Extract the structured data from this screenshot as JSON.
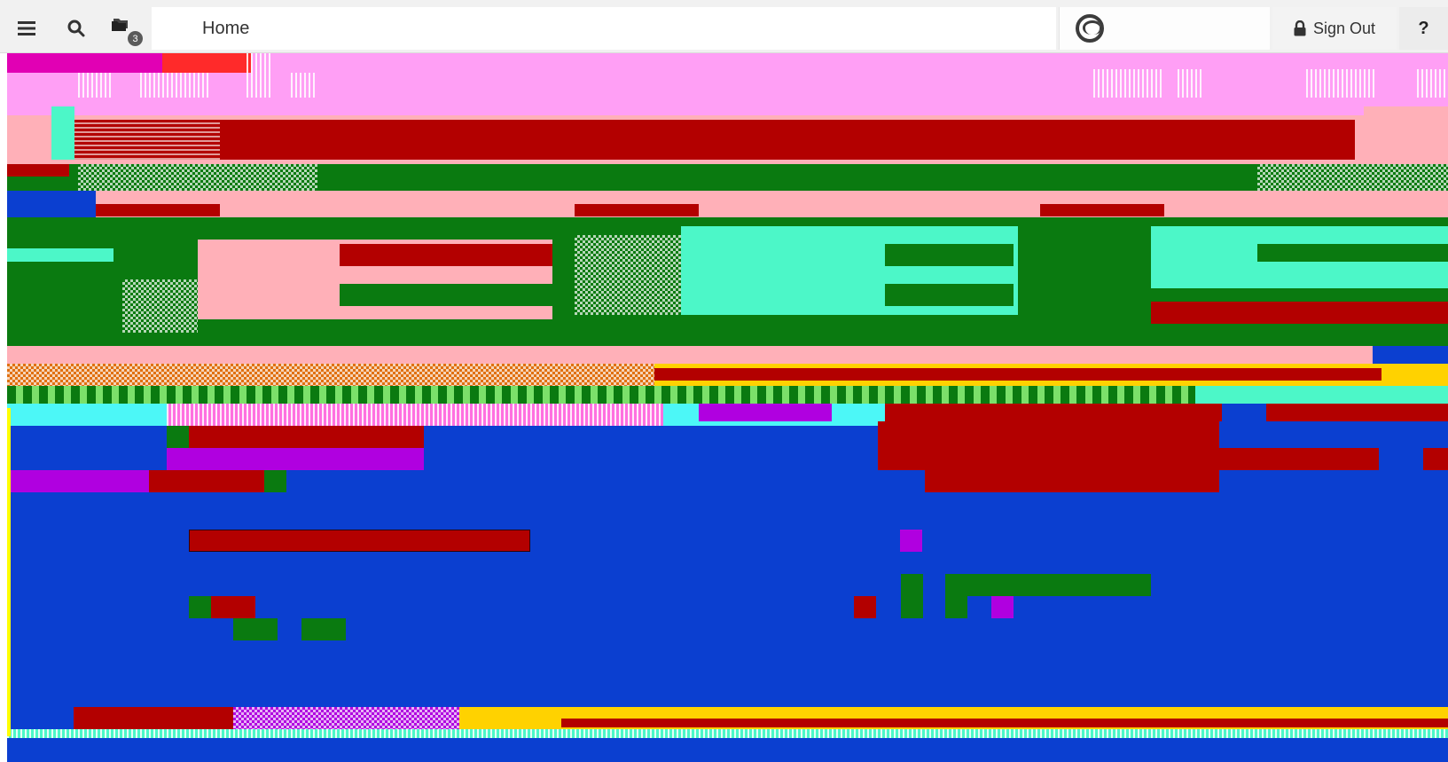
{
  "toolbar": {
    "tasks_badge_count": "3",
    "home_tab_label": "Home",
    "sign_out_label": "Sign Out",
    "help_label": "?"
  },
  "icons": {
    "menu": "hamburger-menu-icon",
    "search": "search-icon",
    "tasks": "folders-icon",
    "user": "user-avatar-icon",
    "lock": "lock-icon"
  },
  "colors": {
    "canvas_blue": "#0b3fd0",
    "artifact_pink": "#ff9ff5",
    "artifact_red": "#b30000",
    "artifact_green": "#0a7a10",
    "artifact_mint": "#4cf7c8",
    "artifact_purple": "#b000e0",
    "artifact_yellow": "#ffd200"
  }
}
